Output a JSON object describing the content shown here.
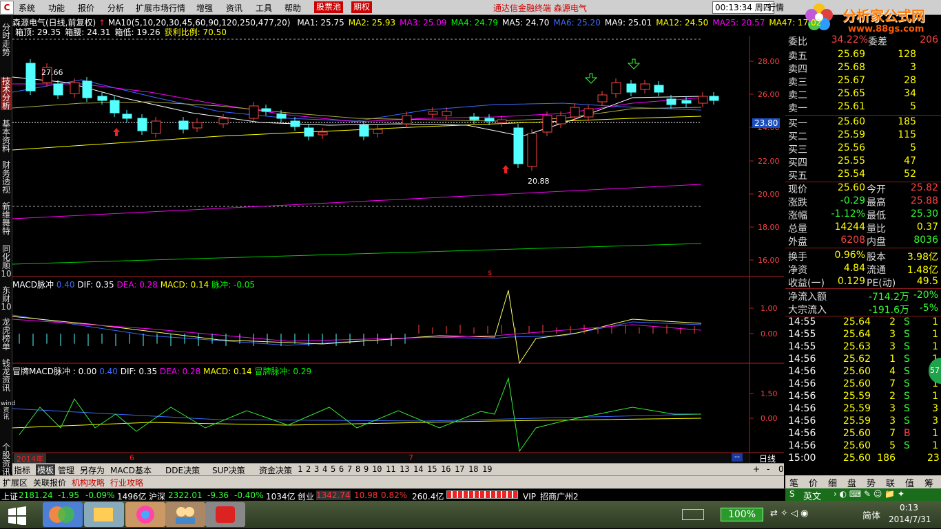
{
  "menu": {
    "items": [
      "系统",
      "功能",
      "报价",
      "分析",
      "扩展市场行情",
      "增强",
      "资讯",
      "工具",
      "帮助"
    ],
    "box1": "股票池",
    "box2": "期权",
    "title": "通达信金融终端  森源电气",
    "clock": "00:13:34",
    "weekday": "周四",
    "hq": "行情"
  },
  "logo": {
    "text": "分析家公式网",
    "url": "www.88gs.com"
  },
  "vtabs": [
    "分时走势",
    "技术分析",
    "基本资料",
    "财务透视",
    "新维舞特",
    "同化顺10",
    "东财10",
    "龙虎榜单",
    "钱龙资讯",
    "wind资讯",
    "个股资讯"
  ],
  "header": {
    "stock": "森源电气(日线,前复权)",
    "ma_def": "MA10(5,10,20,30,45,60,90,120,250,477,20)",
    "mas": [
      {
        "t": "MA1: 25.75",
        "c": "#ffffff"
      },
      {
        "t": "MA2: 25.93",
        "c": "#ffff00"
      },
      {
        "t": "MA3: 25.09",
        "c": "#ff00ff"
      },
      {
        "t": "MA4: 24.79",
        "c": "#00ff00"
      },
      {
        "t": "MA5: 24.70",
        "c": "#ffffff"
      },
      {
        "t": "MA6: 25.20",
        "c": "#3b6bff"
      },
      {
        "t": "MA9: 25.01",
        "c": "#ffffff"
      },
      {
        "t": "MA12: 24.50",
        "c": "#ffff00"
      },
      {
        "t": "MA25: 20.57",
        "c": "#ff00ff"
      },
      {
        "t": "MA47: 17.02",
        "c": "#ffff00"
      }
    ],
    "line2": [
      {
        "t": "箱顶: 29.35",
        "c": "#ffffff"
      },
      {
        "t": "箱腰: 24.31",
        "c": "#ffffff"
      },
      {
        "t": "箱低: 19.26",
        "c": "#ffffff"
      },
      {
        "t": "获利比例: 70.50",
        "c": "#ffff00"
      }
    ]
  },
  "price_axis": [
    "28.00",
    "26.00",
    "24.00",
    "22.00",
    "20.00",
    "18.00",
    "16.00"
  ],
  "price_marker": "23.80",
  "annot_high": "27.66",
  "annot_low": "20.88",
  "macd": {
    "title": "MACD脉冲",
    "v0": "0.40",
    "dif": "DIF: 0.35",
    "dea": "DEA: 0.28",
    "macd": "MACD: 0.14",
    "pulse": "脉冲: -0.05",
    "axis": [
      "1.00",
      "0.00"
    ]
  },
  "mp": {
    "title": "冒牌MACD脉冲 : 0.00",
    "v0": "0.40",
    "dif": "DIF: 0.35",
    "dea": "DEA: 0.28",
    "macd": "MACD: 0.14",
    "pulse": "冒牌脉冲: 0.29",
    "axis": [
      "1.50",
      "0.00"
    ]
  },
  "date_axis": {
    "year": "2014年",
    "m6": "6",
    "m7": "7",
    "period": "日线"
  },
  "tabs": [
    "指标",
    "模板",
    "管理",
    "另存为",
    "MACD基本",
    "DDE决策",
    "SUP决策",
    "资金决策",
    "1",
    "2",
    "3",
    "4",
    "5",
    "6",
    "7",
    "8",
    "9",
    "10",
    "11",
    "13",
    "14",
    "15",
    "16",
    "17",
    "18",
    "19"
  ],
  "tabs2": [
    "扩展区",
    "关联报价",
    "机构攻略",
    "行业攻略"
  ],
  "quote": {
    "top": {
      "label": "委比",
      "value": "34.22%",
      "label2": "委差",
      "value2": "206"
    },
    "asks": [
      [
        "卖五",
        "25.69",
        "128"
      ],
      [
        "卖四",
        "25.68",
        "3"
      ],
      [
        "卖三",
        "25.67",
        "28"
      ],
      [
        "卖二",
        "25.65",
        "34"
      ],
      [
        "卖一",
        "25.61",
        "5"
      ]
    ],
    "bids": [
      [
        "买一",
        "25.60",
        "185"
      ],
      [
        "买二",
        "25.59",
        "115"
      ],
      [
        "买三",
        "25.56",
        "5"
      ],
      [
        "买四",
        "25.55",
        "47"
      ],
      [
        "买五",
        "25.54",
        "52"
      ]
    ],
    "stats": [
      [
        "现价",
        "25.60",
        "今开",
        "25.82"
      ],
      [
        "涨跌",
        "-0.29",
        "最高",
        "25.88"
      ],
      [
        "涨幅",
        "-1.12%",
        "最低",
        "25.30"
      ],
      [
        "总量",
        "14244",
        "量比",
        "0.37"
      ],
      [
        "外盘",
        "6208",
        "内盘",
        "8036"
      ],
      [
        "换手",
        "0.96%",
        "股本",
        "3.98亿"
      ],
      [
        "净资",
        "4.84",
        "流通",
        "1.48亿"
      ],
      [
        "收益(一)",
        "0.129",
        "PE(动)",
        "49.5"
      ]
    ],
    "flow": [
      [
        "净流入额",
        "-714.2万",
        "-20%"
      ],
      [
        "大宗流入",
        "-191.6万",
        "-5%"
      ]
    ],
    "ticks": [
      [
        "14:55",
        "25.64",
        "2",
        "S",
        "1"
      ],
      [
        "14:55",
        "25.64",
        "3",
        "S",
        "1"
      ],
      [
        "14:55",
        "25.63",
        "3",
        "S",
        "1"
      ],
      [
        "14:56",
        "25.62",
        "1",
        "S",
        "1"
      ],
      [
        "14:56",
        "25.60",
        "4",
        "S",
        "1"
      ],
      [
        "14:56",
        "25.60",
        "7",
        "S",
        "1"
      ],
      [
        "14:56",
        "25.59",
        "2",
        "S",
        "1"
      ],
      [
        "14:56",
        "25.59",
        "3",
        "S",
        "3"
      ],
      [
        "14:56",
        "25.59",
        "3",
        "S",
        "3"
      ],
      [
        "14:56",
        "25.60",
        "7",
        "B",
        "1"
      ],
      [
        "14:56",
        "25.60",
        "5",
        "S",
        "1"
      ],
      [
        "15:00",
        "25.60",
        "186",
        "",
        "23"
      ]
    ],
    "side_badge": "57"
  },
  "rtabs": [
    "笔",
    "价",
    "细",
    "盘",
    "势",
    "联",
    "值",
    "筹"
  ],
  "status": {
    "sh": "上证",
    "sh_v": "2181.24",
    "sh_c": "-1.95",
    "sh_p": "-0.09%",
    "sh_a": "1496亿",
    "sz": "沪深",
    "sz_v": "2322.01",
    "sz_c": "-9.36",
    "sz_p": "-0.40%",
    "sz_a": "1034亿",
    "cy": "创业",
    "cy_v": "1342.74",
    "cy_c": "10.98",
    "cy_p": "0.82%",
    "cy_a": "260.4亿",
    "vip": "VIP_招商广州2"
  },
  "ime": {
    "text": "英文"
  },
  "taskbar": {
    "zoom": "100%",
    "lang": "简体",
    "time": "0:13",
    "date": "2014/7/31"
  }
}
